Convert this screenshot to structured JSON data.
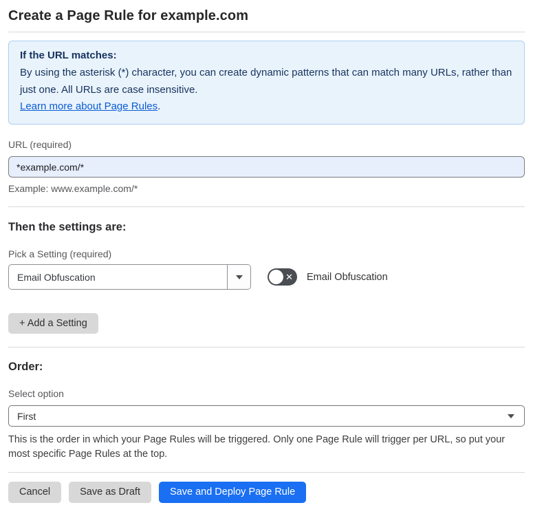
{
  "page": {
    "title": "Create a Page Rule for example.com"
  },
  "info_box": {
    "heading": "If the URL matches:",
    "body": "By using the asterisk (*) character, you can create dynamic patterns that can match many URLs, rather than just one. All URLs are case insensitive.",
    "link_text": "Learn more about Page Rules",
    "link_suffix": "."
  },
  "url_field": {
    "label": "URL (required)",
    "value": "*example.com/*",
    "example": "Example: www.example.com/*"
  },
  "settings_section": {
    "heading": "Then the settings are:",
    "picker_label": "Pick a Setting (required)",
    "picker_value": "Email Obfuscation",
    "toggle_label": "Email Obfuscation",
    "toggle_state": "off",
    "toggle_glyph": "✕",
    "add_button_label": "+ Add a Setting"
  },
  "order_section": {
    "heading": "Order:",
    "select_label": "Select option",
    "select_value": "First",
    "description": "This is the order in which your Page Rules will be triggered. Only one Page Rule will trigger per URL, so put your most specific Page Rules at the top."
  },
  "footer": {
    "cancel_label": "Cancel",
    "save_draft_label": "Save as Draft",
    "save_deploy_label": "Save and Deploy Page Rule"
  },
  "colors": {
    "info_bg": "#e9f3fc",
    "info_border": "#abcfee",
    "info_text": "#16325c",
    "link_blue": "#0b5bd3",
    "input_bg": "#e7eefc",
    "primary_button_blue": "#1a6ff2",
    "gray_button": "#d8d8d8",
    "toggle_off": "#4a4d52",
    "divider": "#d9d9d9"
  }
}
